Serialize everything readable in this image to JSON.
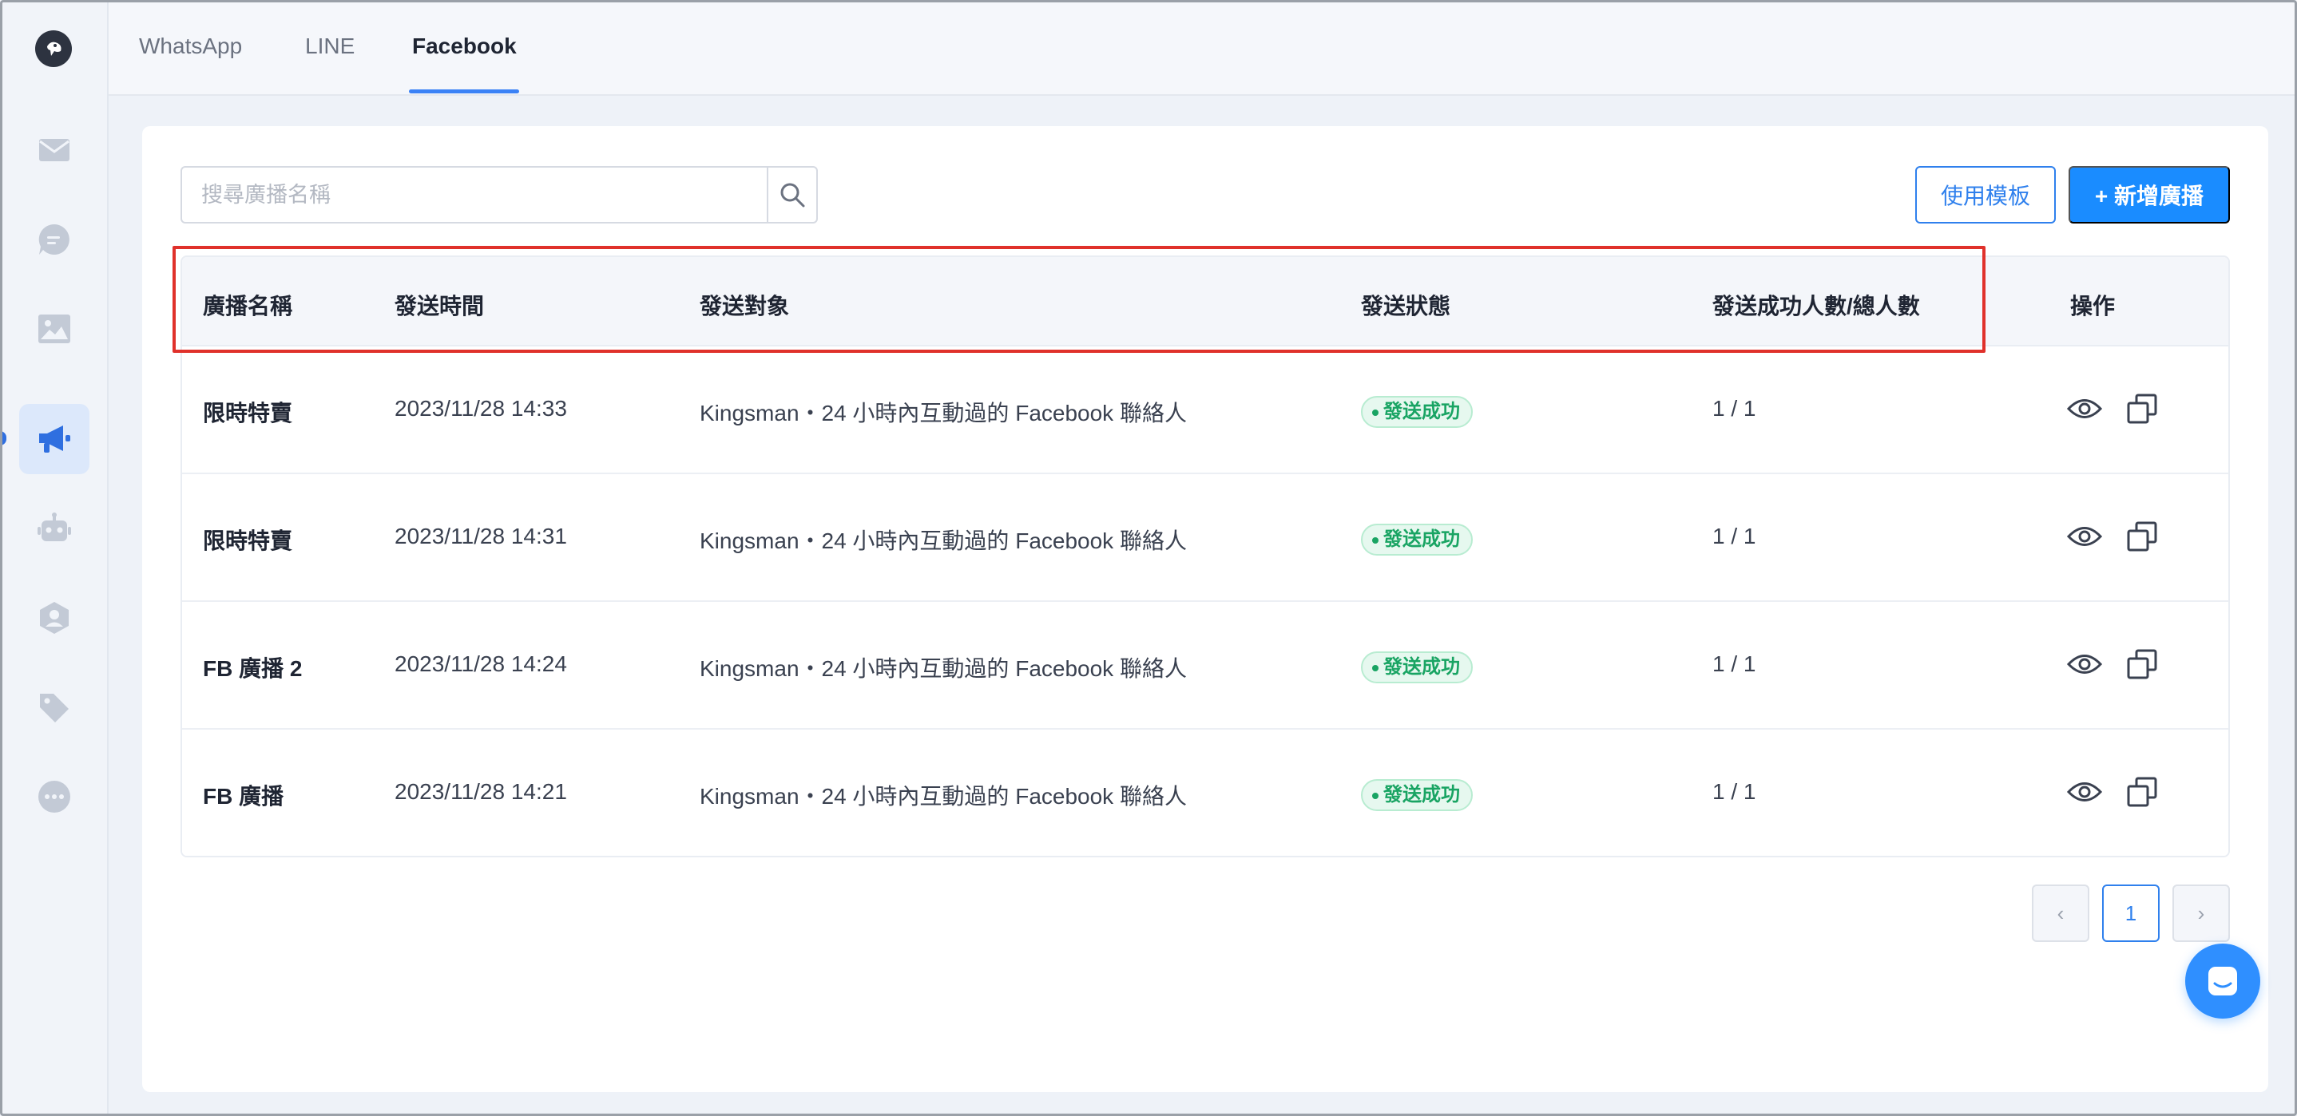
{
  "tabs": [
    {
      "label": "WhatsApp"
    },
    {
      "label": "LINE"
    },
    {
      "label": "Facebook",
      "active": true
    }
  ],
  "sidebar": {
    "icons": [
      "mail-icon",
      "chat-icon",
      "image-icon",
      "megaphone-icon",
      "robot-icon",
      "contact-icon",
      "tag-icon",
      "more-icon"
    ],
    "active": "megaphone-icon"
  },
  "search": {
    "placeholder": "搜尋廣播名稱"
  },
  "toolbar": {
    "template_label": "使用模板",
    "new_label": "+ 新增廣播"
  },
  "table": {
    "headers": [
      "廣播名稱",
      "發送時間",
      "發送對象",
      "發送狀態",
      "發送成功人數/總人數",
      "操作"
    ],
    "rows": [
      {
        "name": "限時特賣",
        "time": "2023/11/28 14:33",
        "target": "Kingsman・24 小時內互動過的 Facebook 聯絡人",
        "status": "發送成功",
        "count": "1 / 1"
      },
      {
        "name": "限時特賣",
        "time": "2023/11/28 14:31",
        "target": "Kingsman・24 小時內互動過的 Facebook 聯絡人",
        "status": "發送成功",
        "count": "1 / 1"
      },
      {
        "name": "FB 廣播 2",
        "time": "2023/11/28 14:24",
        "target": "Kingsman・24 小時內互動過的 Facebook 聯絡人",
        "status": "發送成功",
        "count": "1 / 1"
      },
      {
        "name": "FB 廣播",
        "time": "2023/11/28 14:21",
        "target": "Kingsman・24 小時內互動過的 Facebook 聯絡人",
        "status": "發送成功",
        "count": "1 / 1"
      }
    ]
  },
  "pagination": {
    "prev": "‹",
    "current": "1",
    "next": "›"
  },
  "colors": {
    "accent": "#1a8cff",
    "success": "#19a463",
    "highlight": "#e0312b"
  }
}
